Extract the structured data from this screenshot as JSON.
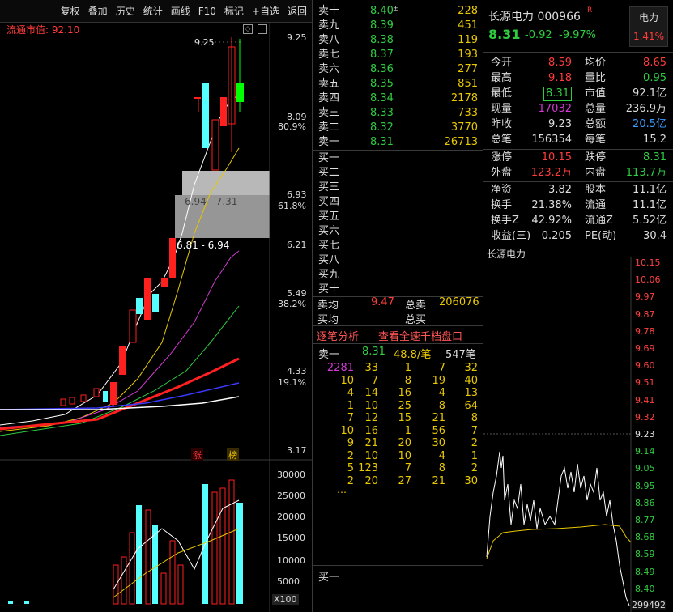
{
  "toolbar": [
    "复权",
    "叠加",
    "历史",
    "统计",
    "画线",
    "F10",
    "标记",
    "+自选",
    "返回"
  ],
  "kline": {
    "market_cap_label": "流通市值: 92.10",
    "price_ticks": [
      "9.25",
      "8.09",
      "6.93",
      "6.21",
      "5.49",
      "4.33",
      "3.17"
    ],
    "pct_ticks": [
      "80.9%",
      "61.8%",
      "38.2%",
      "19.1%"
    ],
    "high_label": "9.25",
    "gap1": "6.94 - 7.31",
    "gap2": "6.81 - 6.94",
    "badge_zhang": "涨",
    "badge_bang": "榜",
    "vol_ticks": [
      "30000",
      "25000",
      "20000",
      "15000",
      "10000",
      "5000"
    ],
    "vol_unit": "X100"
  },
  "orderbook": {
    "asks": [
      {
        "label": "卖十",
        "price": "8.40",
        "sup": "±",
        "vol": "228"
      },
      {
        "label": "卖九",
        "price": "8.39",
        "vol": "451"
      },
      {
        "label": "卖八",
        "price": "8.38",
        "vol": "119"
      },
      {
        "label": "卖七",
        "price": "8.37",
        "vol": "193"
      },
      {
        "label": "卖六",
        "price": "8.36",
        "vol": "277"
      },
      {
        "label": "卖五",
        "price": "8.35",
        "vol": "851"
      },
      {
        "label": "卖四",
        "price": "8.34",
        "vol": "2178"
      },
      {
        "label": "卖三",
        "price": "8.33",
        "vol": "733"
      },
      {
        "label": "卖二",
        "price": "8.32",
        "vol": "3770"
      },
      {
        "label": "卖一",
        "price": "8.31",
        "vol": "26713"
      }
    ],
    "bids": [
      "买一",
      "买二",
      "买三",
      "买四",
      "买五",
      "买六",
      "买七",
      "买八",
      "买九",
      "买十"
    ],
    "avg_sell_label": "卖均",
    "avg_sell_price": "9.47",
    "total_sell_label": "总卖",
    "total_sell": "206076",
    "avg_buy_label": "买均",
    "total_buy_label": "总买"
  },
  "tick_analysis": {
    "title": "逐笔分析",
    "link": "查看全速千档盘口",
    "head_label": "卖一",
    "head_price": "8.31",
    "head_avg": "48.8/笔",
    "head_count": "547笔",
    "rows": [
      [
        "2281",
        "33",
        "1",
        "7",
        "32"
      ],
      [
        "10",
        "7",
        "8",
        "19",
        "40"
      ],
      [
        "4",
        "14",
        "16",
        "4",
        "13"
      ],
      [
        "1",
        "10",
        "25",
        "8",
        "64"
      ],
      [
        "7",
        "12",
        "15",
        "21",
        "8"
      ],
      [
        "10",
        "16",
        "1",
        "56",
        "7"
      ],
      [
        "9",
        "21",
        "20",
        "30",
        "2"
      ],
      [
        "2",
        "10",
        "10",
        "4",
        "1"
      ],
      [
        "5",
        "123",
        "7",
        "8",
        "2"
      ],
      [
        "2",
        "20",
        "27",
        "21",
        "30"
      ]
    ],
    "ellipsis": "…",
    "bottom_label": "买一"
  },
  "quote": {
    "name": "长源电力 000966",
    "r_mark": "R",
    "sector": "电力",
    "sector_pct": "1.41%",
    "price": "8.31",
    "change": "-0.92",
    "pct": "-9.97%",
    "rows1": [
      {
        "l1": "今开",
        "v1": "8.59",
        "l2": "均价",
        "v2": "8.65"
      },
      {
        "l1": "最高",
        "v1": "9.18",
        "l2": "量比",
        "v2": "0.95"
      },
      {
        "l1": "最低",
        "v1": "8.31",
        "l2": "市值",
        "v2": "92.1亿"
      },
      {
        "l1": "现量",
        "v1": "17032",
        "l2": "总量",
        "v2": "236.9万"
      },
      {
        "l1": "昨收",
        "v1": "9.23",
        "l2": "总额",
        "v2": "20.5亿"
      },
      {
        "l1": "总笔",
        "v1": "156354",
        "l2": "每笔",
        "v2": "15.2"
      }
    ],
    "rows2": [
      {
        "l1": "涨停",
        "v1": "10.15",
        "l2": "跌停",
        "v2": "8.31"
      },
      {
        "l1": "外盘",
        "v1": "123.2万",
        "l2": "内盘",
        "v2": "113.7万"
      }
    ],
    "rows3": [
      {
        "l1": "净资",
        "v1": "3.82",
        "l2": "股本",
        "v2": "11.1亿"
      },
      {
        "l1": "换手",
        "v1": "21.38%",
        "l2": "流通",
        "v2": "11.1亿"
      },
      {
        "l1": "换手Z",
        "v1": "42.92%",
        "l2": "流通Z",
        "v2": "5.52亿"
      },
      {
        "l1": "收益(三)",
        "v1": "0.205",
        "l2": "PE(动)",
        "v2": "30.4"
      }
    ]
  },
  "intraday": {
    "title": "长源电力",
    "ticks": [
      "10.15",
      "10.06",
      "9.97",
      "9.87",
      "9.78",
      "9.69",
      "9.60",
      "9.51",
      "9.41",
      "9.32",
      "9.23",
      "9.14",
      "9.05",
      "8.95",
      "8.86",
      "8.77",
      "8.68",
      "8.59",
      "8.49",
      "8.40"
    ],
    "volume_label": "299492"
  },
  "colors": {
    "up": "#ff3b3b",
    "down": "#2ecc40",
    "accent": "#3a9cff",
    "bg": "#000000"
  }
}
